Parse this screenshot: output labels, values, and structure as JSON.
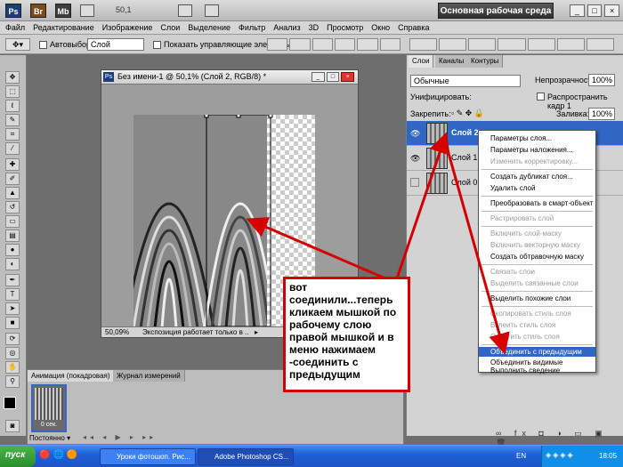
{
  "appbar": {
    "ps_logo": "Ps",
    "br_label": "Br",
    "mb_label": "Mb",
    "zoom": "50,1",
    "workspace": "Основная рабочая среда"
  },
  "menu": [
    "Файл",
    "Редактирование",
    "Изображение",
    "Слои",
    "Выделение",
    "Фильтр",
    "Анализ",
    "3D",
    "Просмотр",
    "Окно",
    "Справка"
  ],
  "options": {
    "autoselect_label": "Автовыбор:",
    "autoselect_value": "Слой",
    "show_controls": "Показать управляющие элементы"
  },
  "document": {
    "title": "Без имени-1 @ 50,1% (Слой 2, RGB/8) *",
    "zoom": "50,09%",
    "status": "Экспозиция работает только в ..."
  },
  "animation": {
    "tab_active": "Анимация (покадровая)",
    "tab_other": "Журнал измерений",
    "frame_time": "0 сек.",
    "loop": "Постоянно"
  },
  "layers_panel": {
    "tabs": [
      "Слои",
      "Каналы",
      "Контуры"
    ],
    "blend_mode": "Обычные",
    "opacity_label": "Непрозрачность:",
    "opacity_value": "100%",
    "unify_label": "Унифицировать:",
    "propagate_label": "Распространить кадр 1",
    "lock_label": "Закрепить:",
    "fill_label": "Заливка:",
    "fill_value": "100%",
    "layers": [
      {
        "name": "Слой 2"
      },
      {
        "name": "Слой 1"
      },
      {
        "name": "Слой 0"
      }
    ]
  },
  "context_menu": {
    "items": [
      {
        "label": "Параметры слоя...",
        "disabled": false
      },
      {
        "label": "Параметры наложения...",
        "disabled": false
      },
      {
        "label": "Изменить корректировку...",
        "disabled": true
      },
      {
        "label": "Создать дубликат слоя...",
        "disabled": false
      },
      {
        "label": "Удалить слой",
        "disabled": false
      },
      {
        "label": "Преобразовать в смарт-объект",
        "disabled": false
      },
      {
        "label": "Растрировать слой",
        "disabled": true
      },
      {
        "label": "Включить слой-маску",
        "disabled": true
      },
      {
        "label": "Включить векторную маску",
        "disabled": true
      },
      {
        "label": "Создать обтравочную маску",
        "disabled": false
      },
      {
        "label": "Связать слои",
        "disabled": true
      },
      {
        "label": "Выделить связанные слои",
        "disabled": true
      },
      {
        "label": "Выделить похожие слои",
        "disabled": false
      },
      {
        "label": "Скопировать стиль слоя",
        "disabled": true
      },
      {
        "label": "Вклеить стиль слоя",
        "disabled": true
      },
      {
        "label": "Очистить стиль слоя",
        "disabled": true
      },
      {
        "label": "Объединить с предыдущим",
        "disabled": false,
        "highlight": true
      },
      {
        "label": "Объединить видимые",
        "disabled": false
      },
      {
        "label": "Выполнить сведение",
        "disabled": false
      }
    ]
  },
  "annotation": "вот соединили...теперь кликаем мышкой по рабочему слою правой мышкой  и в меню нажимаем -соединить с предыдущим",
  "taskbar": {
    "start_label": "пуск",
    "tasks": [
      "Уроки фотошоп. Рис...",
      "Adobe Photoshop CS..."
    ],
    "lang": "EN",
    "time": "18:05"
  },
  "colors": {
    "annotation_red": "#d60000",
    "menu_highlight": "#3067c4",
    "taskbar_blue": "#1f5fd6"
  }
}
